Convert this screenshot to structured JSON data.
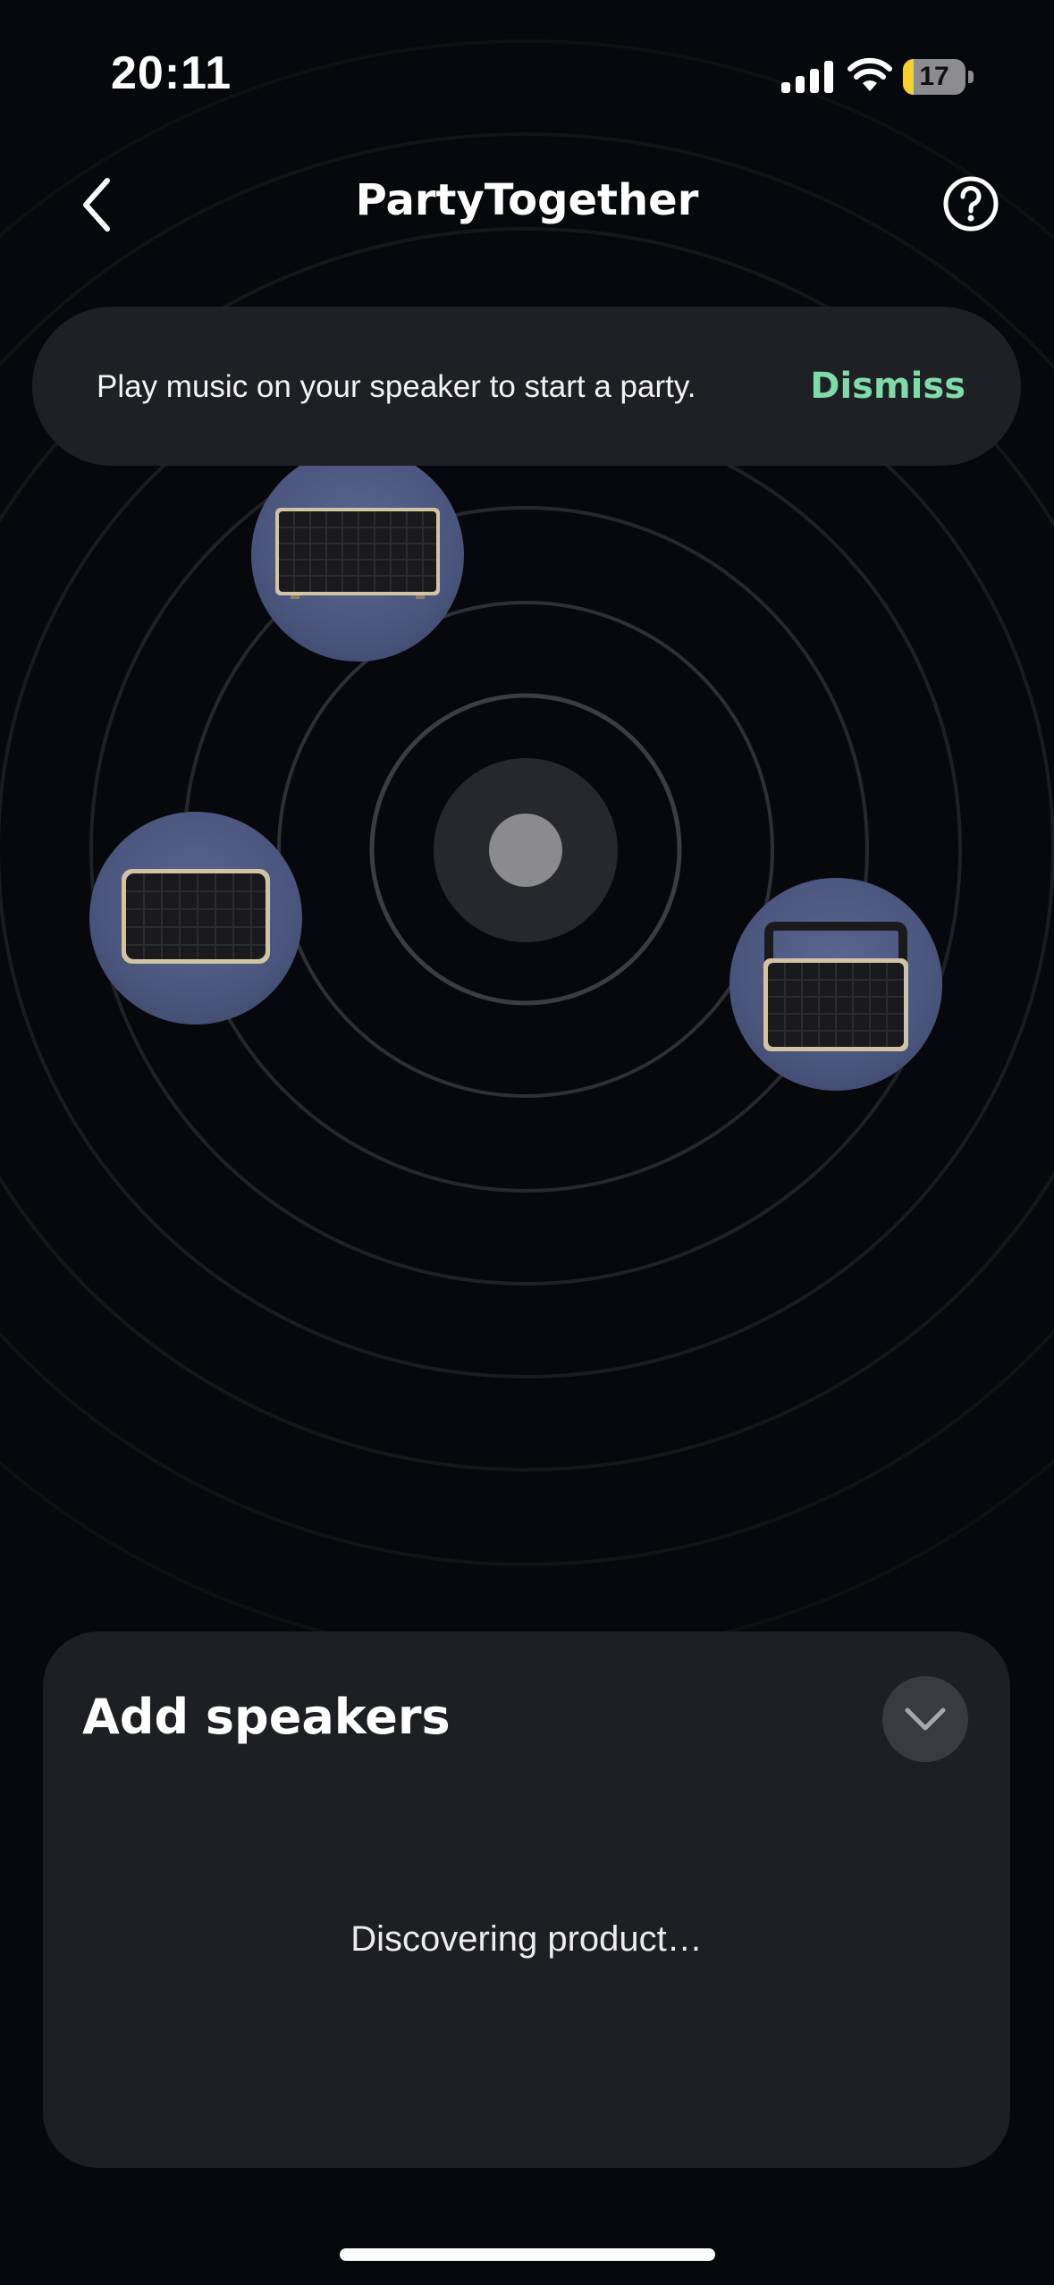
{
  "status_bar": {
    "time": "20:11",
    "battery_level": "17",
    "battery_fraction": 0.17,
    "battery_color": "#f7d02a"
  },
  "header": {
    "title": "PartyTogether",
    "back_icon": "chevron-left-icon",
    "help_icon": "question-circle-icon"
  },
  "banner": {
    "message": "Play music on your speaker to start a party.",
    "dismiss_label": "Dismiss",
    "dismiss_color": "#7fdcaa"
  },
  "radar": {
    "speakers": [
      {
        "id": "speaker-1",
        "icon": "speaker-landscape-icon"
      },
      {
        "id": "speaker-2",
        "icon": "speaker-compact-icon"
      },
      {
        "id": "speaker-3",
        "icon": "speaker-handle-icon"
      }
    ]
  },
  "sheet": {
    "title": "Add speakers",
    "collapse_icon": "chevron-down-icon",
    "status": "Discovering product…"
  }
}
